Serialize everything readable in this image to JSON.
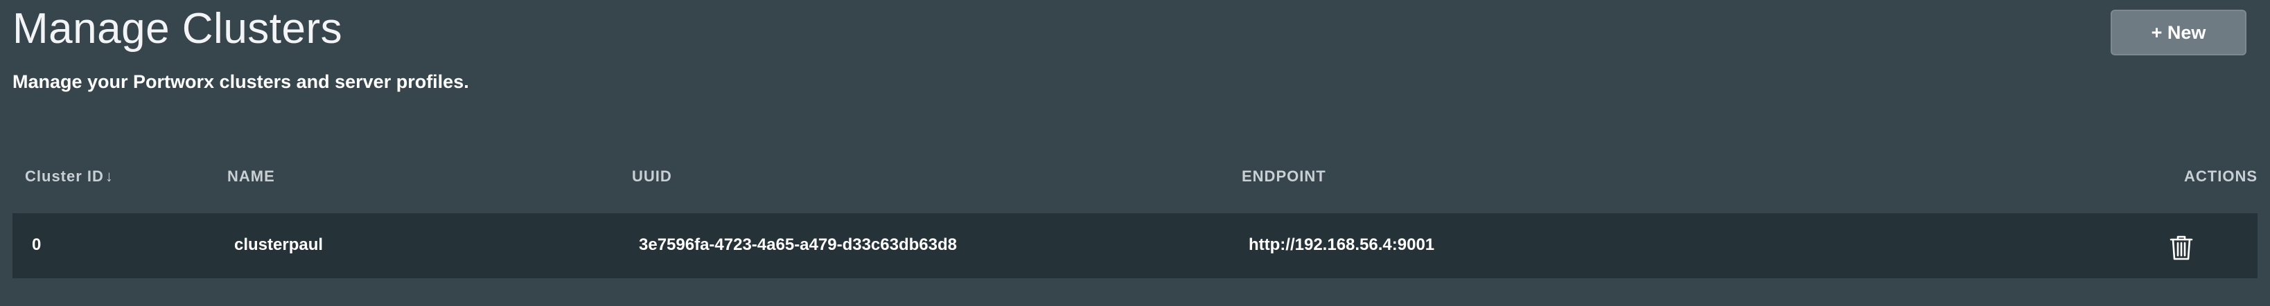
{
  "header": {
    "title": "Manage Clusters",
    "subtitle": "Manage your Portworx clusters and server profiles.",
    "new_button_label": "+ New"
  },
  "table": {
    "columns": {
      "cluster_id": "Cluster ID",
      "cluster_id_sort": "↓",
      "name": "NAME",
      "uuid": "UUID",
      "endpoint": "ENDPOINT",
      "actions": "ACTIONS"
    },
    "rows": [
      {
        "cluster_id": "0",
        "name": "clusterpaul",
        "uuid": "3e7596fa-4723-4a65-a479-d33c63db63d8",
        "endpoint": "http://192.168.56.4:9001",
        "action_icon": "trash-icon"
      }
    ]
  }
}
